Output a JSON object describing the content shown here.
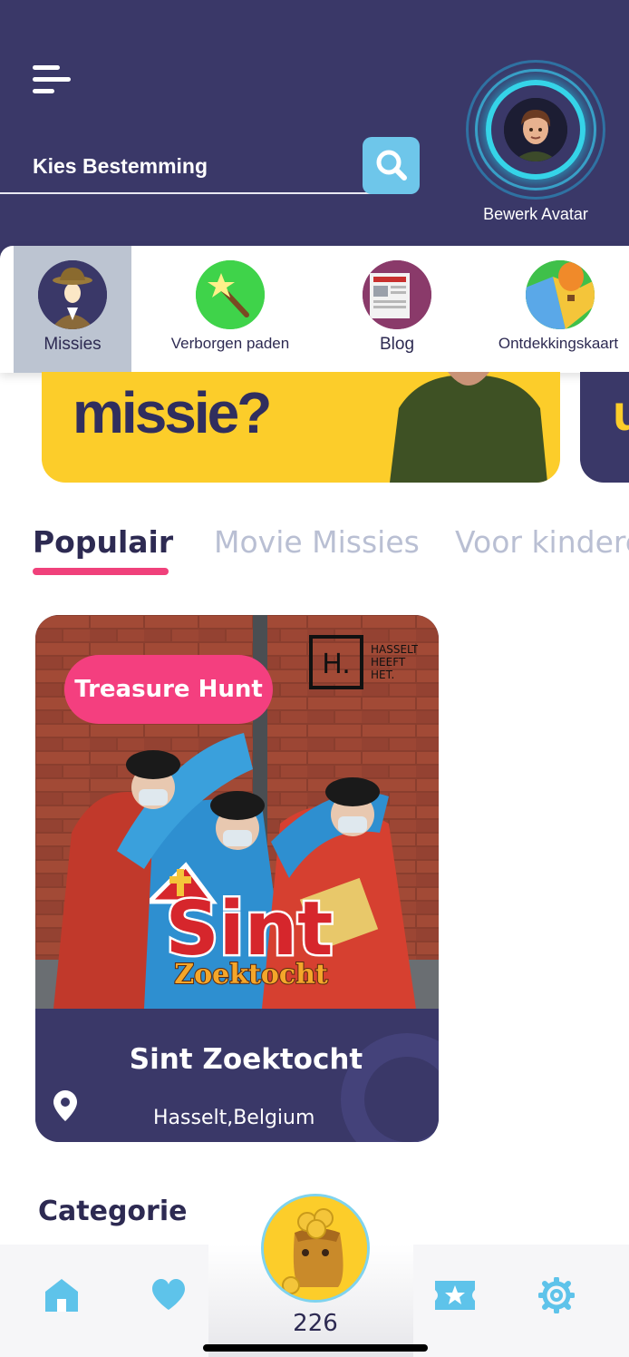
{
  "header": {
    "destination_label": "Kies Bestemming",
    "avatar_caption": "Bewerk Avatar"
  },
  "categories": [
    {
      "label": "Missies",
      "icon": "detective-icon",
      "active": true
    },
    {
      "label": "Verborgen paden",
      "icon": "magic-wand-icon",
      "active": false
    },
    {
      "label": "Blog",
      "icon": "newspaper-icon",
      "active": false
    },
    {
      "label": "Ontdekkingskaart",
      "icon": "map-balloon-icon",
      "active": false
    }
  ],
  "banner": {
    "text": "missie?"
  },
  "tabs": [
    {
      "label": "Populair",
      "active": true
    },
    {
      "label": "Movie Missies",
      "active": false
    },
    {
      "label": "Voor kindere",
      "active": false
    }
  ],
  "mission_card": {
    "badge": "Treasure Hunt",
    "brand_lines": [
      "HASSELT",
      "HEEFT",
      "HET."
    ],
    "brand_mark": "H.",
    "logo_word_1": "Sint",
    "logo_word_2": "Zoektocht",
    "title": "Sint Zoektocht",
    "location": "Hasselt,Belgium"
  },
  "section_title": "Categorie",
  "bottom_nav": {
    "coin_count": "226",
    "items": [
      "home-icon",
      "heart-icon",
      "coin-bag-icon",
      "ticket-star-icon",
      "gear-icon"
    ]
  },
  "colors": {
    "header_bg": "#3a3868",
    "accent_pink": "#f0417b",
    "accent_cyan": "#6ec6ea",
    "banner_yellow": "#fccd2a"
  }
}
